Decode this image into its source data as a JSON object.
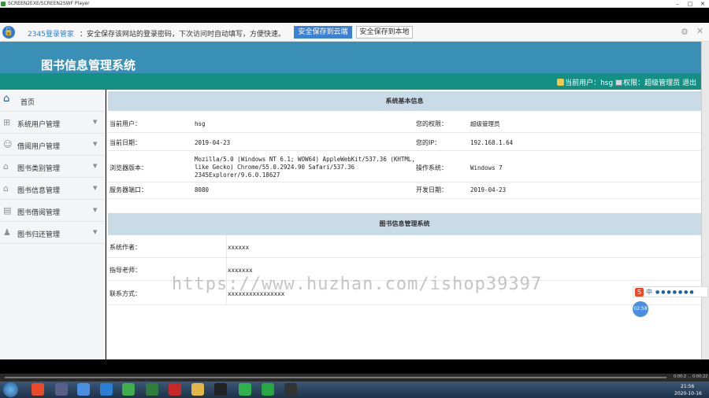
{
  "player": {
    "title": "SCREEN2EXE/SCREEN2SWF Player",
    "time": "0:00:2 ... 0:00:22"
  },
  "password_bar": {
    "brand": "2345登录管家",
    "message": "：安全保存该网站的登录密码，下次访问时自动填写，方便快速。",
    "save_cloud": "安全保存到云端",
    "save_local": "安全保存到本地"
  },
  "header": {
    "title": "图书信息管理系统",
    "user_label": "当前用户：",
    "user_name": "hsg",
    "role_label": "权限：",
    "role_name": "超级管理员",
    "logout": "退出"
  },
  "sidebar": {
    "items": [
      {
        "label": "首页",
        "icon": "home-icon"
      },
      {
        "label": "系统用户管理",
        "icon": "grid-icon"
      },
      {
        "label": "借阅用户管理",
        "icon": "user-icon"
      },
      {
        "label": "图书类别管理",
        "icon": "house-icon"
      },
      {
        "label": "图书信息管理",
        "icon": "house-icon"
      },
      {
        "label": "图书借阅管理",
        "icon": "doc-icon"
      },
      {
        "label": "图书归还管理",
        "icon": "person-icon"
      }
    ]
  },
  "system_info": {
    "heading": "系统基本信息",
    "rows": [
      {
        "l1": "当前用户：",
        "v1": "hsg",
        "l2": "您的权限：",
        "v2": "超级管理员"
      },
      {
        "l1": "当前日期：",
        "v1": "2019-04-23",
        "l2": "您的IP：",
        "v2": "192.168.1.64"
      },
      {
        "l1": "浏览器版本：",
        "v1": "Mozilla/5.0 (Windows NT 6.1; WOW64) AppleWebKit/537.36 (KHTML, like Gecko) Chrome/55.0.2924.90 Safari/537.36 2345Explorer/9.6.0.18627",
        "l2": "操作系统：",
        "v2": "Windows 7"
      },
      {
        "l1": "服务器端口：",
        "v1": "8080",
        "l2": "开发日期：",
        "v2": "2019-04-23"
      }
    ]
  },
  "about": {
    "heading": "图书信息管理系统",
    "rows": [
      {
        "label": "系统作者：",
        "value": "xxxxxx"
      },
      {
        "label": "指导老师：",
        "value": "xxxxxxx"
      },
      {
        "label": "联系方式：",
        "value": "xxxxxxxxxxxxxxxx"
      }
    ]
  },
  "overlay": {
    "watermark": "https://www.huzhan.com/ishop39397",
    "ime_label": "中",
    "ime_s": "S",
    "timer": "02:58"
  },
  "taskbar": {
    "clock_time": "21:56",
    "clock_date": "2020-10-16"
  }
}
